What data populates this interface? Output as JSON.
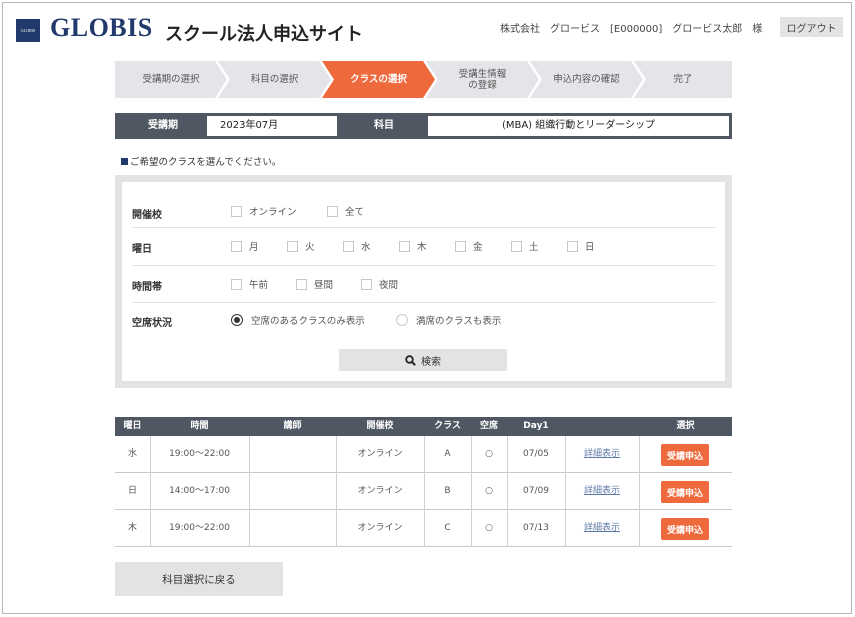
{
  "header": {
    "logo_small": "GLOBIS",
    "logo_text": "GLOBIS",
    "site_title": "スクール法人申込サイト",
    "user_info": "株式会社　グロービス　[E000000]　グロービス太郎　様",
    "logout_label": "ログアウト"
  },
  "steps": [
    {
      "label": "受講期の選択",
      "active": false
    },
    {
      "label": "科目の選択",
      "active": false
    },
    {
      "label": "クラスの選択",
      "active": true
    },
    {
      "label": "受講生情報\nの登録",
      "active": false
    },
    {
      "label": "申込内容の確認",
      "active": false
    },
    {
      "label": "完了",
      "active": false
    }
  ],
  "info": {
    "term_label": "受講期",
    "term_value": "2023年07月",
    "subject_label": "科目",
    "subject_value": "(MBA) 組織行動とリーダーシップ"
  },
  "instruction": "ご希望のクラスを選んでください。",
  "filters": {
    "venue": {
      "label": "開催校",
      "options": [
        "オンライン",
        "全て"
      ]
    },
    "weekday": {
      "label": "曜日",
      "options": [
        "月",
        "火",
        "水",
        "木",
        "金",
        "土",
        "日"
      ]
    },
    "timeslot": {
      "label": "時間帯",
      "options": [
        "午前",
        "昼間",
        "夜間"
      ]
    },
    "vacancy": {
      "label": "空席状況",
      "options": [
        "空席のあるクラスのみ表示",
        "満席のクラスも表示"
      ],
      "selected": "空席のあるクラスのみ表示"
    }
  },
  "search_label": "検索",
  "table": {
    "headers": [
      "曜日",
      "時間",
      "講師",
      "開催校",
      "クラス",
      "空席",
      "Day1",
      "",
      "選択"
    ],
    "rows": [
      {
        "day": "水",
        "time": "19:00～22:00",
        "teacher": "",
        "venue": "オンライン",
        "class": "A",
        "vacancy": "○",
        "day1": "07/05",
        "detail": "詳細表示",
        "apply": "受講申込"
      },
      {
        "day": "日",
        "time": "14:00～17:00",
        "teacher": "",
        "venue": "オンライン",
        "class": "B",
        "vacancy": "○",
        "day1": "07/09",
        "detail": "詳細表示",
        "apply": "受講申込"
      },
      {
        "day": "木",
        "time": "19:00～22:00",
        "teacher": "",
        "venue": "オンライン",
        "class": "C",
        "vacancy": "○",
        "day1": "07/13",
        "detail": "詳細表示",
        "apply": "受講申込"
      }
    ]
  },
  "back_label": "科目選択に戻る",
  "colors": {
    "brand": "#213a6b",
    "accent": "#ee6a3c",
    "dark": "#4f5763",
    "step_bg": "#e3e5e8"
  }
}
